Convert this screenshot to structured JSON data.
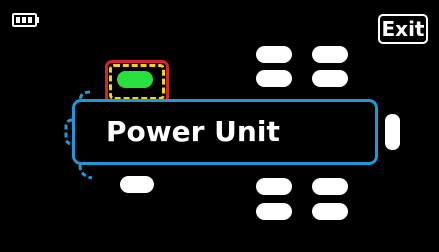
{
  "header": {
    "battery_icon": "battery-icon",
    "exit_label": "Exit"
  },
  "unit": {
    "label": "Power Unit",
    "border_color": "#1f9ad8"
  },
  "selection": {
    "connector_color": "#28e03c",
    "highlight_outer_color": "#d8242c",
    "highlight_dash_color": "#f3d21a"
  }
}
